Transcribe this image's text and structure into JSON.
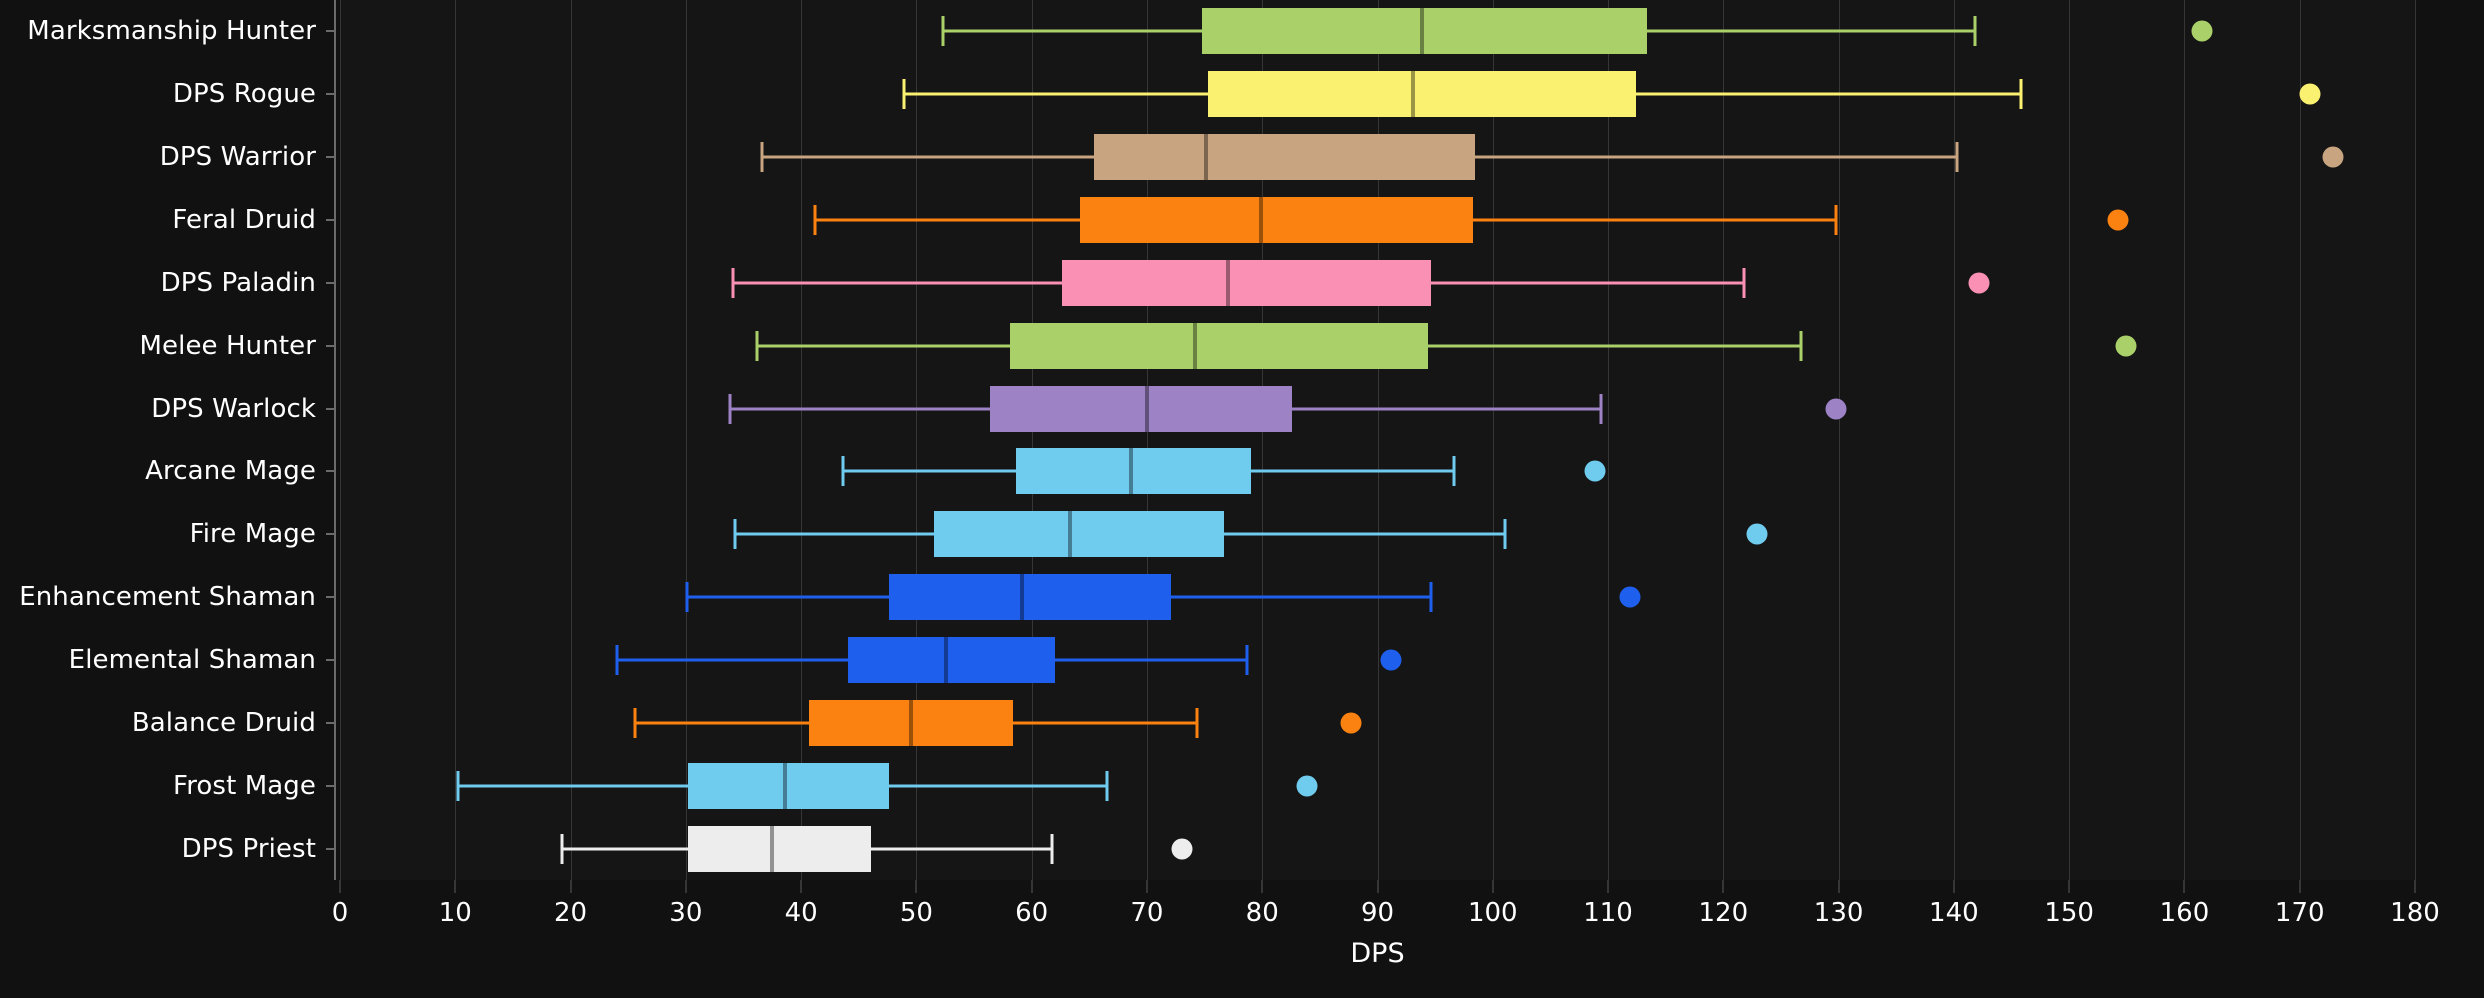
{
  "chart_data": {
    "type": "box",
    "title": "",
    "xlabel": "DPS",
    "ylabel": "",
    "xlim": [
      0,
      180
    ],
    "xticks": [
      0,
      10,
      20,
      30,
      40,
      50,
      60,
      70,
      80,
      90,
      100,
      110,
      120,
      130,
      140,
      150,
      160,
      170,
      180
    ],
    "xtick_labels": [
      "0",
      "10",
      "20",
      "30",
      "40",
      "50",
      "60",
      "70",
      "80",
      "90",
      "100",
      "110",
      "120",
      "130",
      "140",
      "150",
      "160",
      "170",
      "180"
    ],
    "grid": true,
    "orientation": "horizontal",
    "legend": "none",
    "background_color": "#111111",
    "plot_background_color": "#151515",
    "gridline_color": "#363636",
    "text_color": "#ffffff",
    "categories": [
      "Marksmanship Hunter",
      "DPS Rogue",
      "DPS Warrior",
      "Feral Druid",
      "DPS Paladin",
      "Melee Hunter",
      "DPS Warlock",
      "Arcane Mage",
      "Fire Mage",
      "Enhancement Shaman",
      "Elemental Shaman",
      "Balance Druid",
      "Frost Mage",
      "DPS Priest"
    ],
    "boxes": [
      {
        "label": "Marksmanship Hunter",
        "color": "#aad06a",
        "whisker_low": 52.3,
        "q1": 74.8,
        "median": 93.9,
        "q3": 113.4,
        "whisker_high": 141.8,
        "outliers": [
          161.5
        ]
      },
      {
        "label": "DPS Rogue",
        "color": "#faf171",
        "whisker_low": 48.9,
        "q1": 75.3,
        "median": 93.1,
        "q3": 112.4,
        "whisker_high": 145.8,
        "outliers": [
          170.9
        ]
      },
      {
        "label": "DPS Warrior",
        "color": "#c8a481",
        "whisker_low": 36.6,
        "q1": 65.4,
        "median": 75.1,
        "q3": 98.5,
        "whisker_high": 140.3,
        "outliers": [
          172.9
        ]
      },
      {
        "label": "Feral Druid",
        "color": "#fb8211",
        "whisker_low": 41.2,
        "q1": 64.2,
        "median": 79.9,
        "q3": 98.3,
        "whisker_high": 129.8,
        "outliers": [
          154.2
        ]
      },
      {
        "label": "DPS Paladin",
        "color": "#fa91b4",
        "whisker_low": 34.1,
        "q1": 62.6,
        "median": 77.0,
        "q3": 94.6,
        "whisker_high": 121.8,
        "outliers": [
          142.2
        ]
      },
      {
        "label": "Melee Hunter",
        "color": "#aad06a",
        "whisker_low": 36.2,
        "q1": 58.1,
        "median": 74.2,
        "q3": 94.4,
        "whisker_high": 126.7,
        "outliers": [
          154.9
        ]
      },
      {
        "label": "DPS Warlock",
        "color": "#9d82c5",
        "whisker_low": 33.8,
        "q1": 56.4,
        "median": 70.0,
        "q3": 82.6,
        "whisker_high": 109.4,
        "outliers": [
          129.8
        ]
      },
      {
        "label": "Arcane Mage",
        "color": "#6fccee",
        "whisker_low": 43.6,
        "q1": 58.6,
        "median": 68.6,
        "q3": 79.0,
        "whisker_high": 96.6,
        "outliers": [
          108.9
        ]
      },
      {
        "label": "Fire Mage",
        "color": "#6fccee",
        "whisker_low": 34.3,
        "q1": 51.5,
        "median": 63.3,
        "q3": 76.7,
        "whisker_high": 101.1,
        "outliers": [
          122.9
        ]
      },
      {
        "label": "Enhancement Shaman",
        "color": "#1f5fee",
        "whisker_low": 30.1,
        "q1": 47.6,
        "median": 59.2,
        "q3": 72.1,
        "whisker_high": 94.6,
        "outliers": [
          111.9
        ]
      },
      {
        "label": "Elemental Shaman",
        "color": "#1f5fee",
        "whisker_low": 24.0,
        "q1": 44.1,
        "median": 52.6,
        "q3": 62.0,
        "whisker_high": 78.7,
        "outliers": [
          91.2
        ]
      },
      {
        "label": "Balance Druid",
        "color": "#fb8211",
        "whisker_low": 25.6,
        "q1": 40.7,
        "median": 49.5,
        "q3": 58.4,
        "whisker_high": 74.3,
        "outliers": [
          87.7
        ]
      },
      {
        "label": "Frost Mage",
        "color": "#6fccee",
        "whisker_low": 10.2,
        "q1": 30.2,
        "median": 38.6,
        "q3": 47.6,
        "whisker_high": 66.5,
        "outliers": [
          83.9
        ]
      },
      {
        "label": "DPS Priest",
        "color": "#ededed",
        "whisker_low": 19.3,
        "q1": 30.2,
        "median": 37.5,
        "q3": 46.1,
        "whisker_high": 61.8,
        "outliers": [
          73.0
        ]
      }
    ]
  }
}
